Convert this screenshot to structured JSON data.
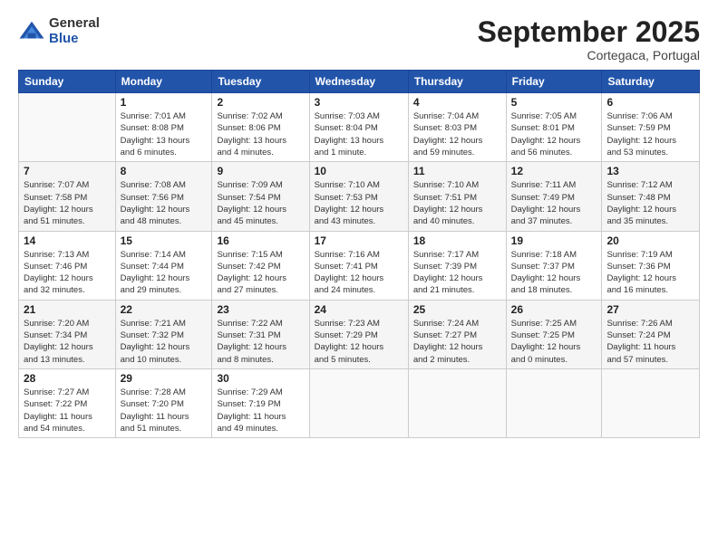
{
  "logo": {
    "general": "General",
    "blue": "Blue"
  },
  "title": "September 2025",
  "subtitle": "Cortegaca, Portugal",
  "days_of_week": [
    "Sunday",
    "Monday",
    "Tuesday",
    "Wednesday",
    "Thursday",
    "Friday",
    "Saturday"
  ],
  "weeks": [
    [
      {
        "day": "",
        "info": ""
      },
      {
        "day": "1",
        "info": "Sunrise: 7:01 AM\nSunset: 8:08 PM\nDaylight: 13 hours\nand 6 minutes."
      },
      {
        "day": "2",
        "info": "Sunrise: 7:02 AM\nSunset: 8:06 PM\nDaylight: 13 hours\nand 4 minutes."
      },
      {
        "day": "3",
        "info": "Sunrise: 7:03 AM\nSunset: 8:04 PM\nDaylight: 13 hours\nand 1 minute."
      },
      {
        "day": "4",
        "info": "Sunrise: 7:04 AM\nSunset: 8:03 PM\nDaylight: 12 hours\nand 59 minutes."
      },
      {
        "day": "5",
        "info": "Sunrise: 7:05 AM\nSunset: 8:01 PM\nDaylight: 12 hours\nand 56 minutes."
      },
      {
        "day": "6",
        "info": "Sunrise: 7:06 AM\nSunset: 7:59 PM\nDaylight: 12 hours\nand 53 minutes."
      }
    ],
    [
      {
        "day": "7",
        "info": "Sunrise: 7:07 AM\nSunset: 7:58 PM\nDaylight: 12 hours\nand 51 minutes."
      },
      {
        "day": "8",
        "info": "Sunrise: 7:08 AM\nSunset: 7:56 PM\nDaylight: 12 hours\nand 48 minutes."
      },
      {
        "day": "9",
        "info": "Sunrise: 7:09 AM\nSunset: 7:54 PM\nDaylight: 12 hours\nand 45 minutes."
      },
      {
        "day": "10",
        "info": "Sunrise: 7:10 AM\nSunset: 7:53 PM\nDaylight: 12 hours\nand 43 minutes."
      },
      {
        "day": "11",
        "info": "Sunrise: 7:10 AM\nSunset: 7:51 PM\nDaylight: 12 hours\nand 40 minutes."
      },
      {
        "day": "12",
        "info": "Sunrise: 7:11 AM\nSunset: 7:49 PM\nDaylight: 12 hours\nand 37 minutes."
      },
      {
        "day": "13",
        "info": "Sunrise: 7:12 AM\nSunset: 7:48 PM\nDaylight: 12 hours\nand 35 minutes."
      }
    ],
    [
      {
        "day": "14",
        "info": "Sunrise: 7:13 AM\nSunset: 7:46 PM\nDaylight: 12 hours\nand 32 minutes."
      },
      {
        "day": "15",
        "info": "Sunrise: 7:14 AM\nSunset: 7:44 PM\nDaylight: 12 hours\nand 29 minutes."
      },
      {
        "day": "16",
        "info": "Sunrise: 7:15 AM\nSunset: 7:42 PM\nDaylight: 12 hours\nand 27 minutes."
      },
      {
        "day": "17",
        "info": "Sunrise: 7:16 AM\nSunset: 7:41 PM\nDaylight: 12 hours\nand 24 minutes."
      },
      {
        "day": "18",
        "info": "Sunrise: 7:17 AM\nSunset: 7:39 PM\nDaylight: 12 hours\nand 21 minutes."
      },
      {
        "day": "19",
        "info": "Sunrise: 7:18 AM\nSunset: 7:37 PM\nDaylight: 12 hours\nand 18 minutes."
      },
      {
        "day": "20",
        "info": "Sunrise: 7:19 AM\nSunset: 7:36 PM\nDaylight: 12 hours\nand 16 minutes."
      }
    ],
    [
      {
        "day": "21",
        "info": "Sunrise: 7:20 AM\nSunset: 7:34 PM\nDaylight: 12 hours\nand 13 minutes."
      },
      {
        "day": "22",
        "info": "Sunrise: 7:21 AM\nSunset: 7:32 PM\nDaylight: 12 hours\nand 10 minutes."
      },
      {
        "day": "23",
        "info": "Sunrise: 7:22 AM\nSunset: 7:31 PM\nDaylight: 12 hours\nand 8 minutes."
      },
      {
        "day": "24",
        "info": "Sunrise: 7:23 AM\nSunset: 7:29 PM\nDaylight: 12 hours\nand 5 minutes."
      },
      {
        "day": "25",
        "info": "Sunrise: 7:24 AM\nSunset: 7:27 PM\nDaylight: 12 hours\nand 2 minutes."
      },
      {
        "day": "26",
        "info": "Sunrise: 7:25 AM\nSunset: 7:25 PM\nDaylight: 12 hours\nand 0 minutes."
      },
      {
        "day": "27",
        "info": "Sunrise: 7:26 AM\nSunset: 7:24 PM\nDaylight: 11 hours\nand 57 minutes."
      }
    ],
    [
      {
        "day": "28",
        "info": "Sunrise: 7:27 AM\nSunset: 7:22 PM\nDaylight: 11 hours\nand 54 minutes."
      },
      {
        "day": "29",
        "info": "Sunrise: 7:28 AM\nSunset: 7:20 PM\nDaylight: 11 hours\nand 51 minutes."
      },
      {
        "day": "30",
        "info": "Sunrise: 7:29 AM\nSunset: 7:19 PM\nDaylight: 11 hours\nand 49 minutes."
      },
      {
        "day": "",
        "info": ""
      },
      {
        "day": "",
        "info": ""
      },
      {
        "day": "",
        "info": ""
      },
      {
        "day": "",
        "info": ""
      }
    ]
  ]
}
